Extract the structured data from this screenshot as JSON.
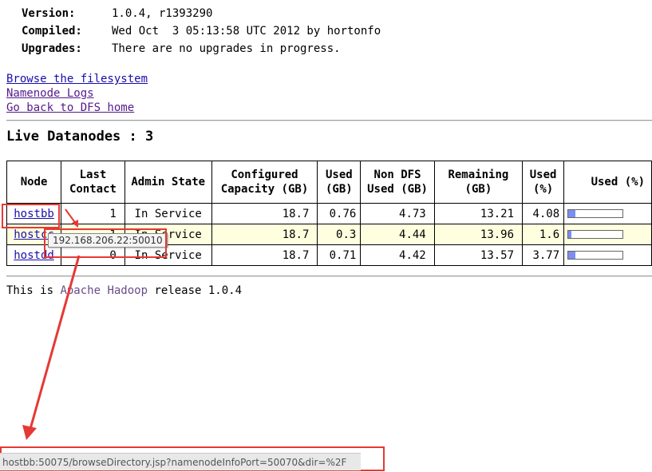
{
  "info": [
    {
      "label": "Version:",
      "value": "1.0.4, r1393290"
    },
    {
      "label": "Compiled:",
      "value": "Wed Oct  3 05:13:58 UTC 2012 by hortonfo"
    },
    {
      "label": "Upgrades:",
      "value": "There are no upgrades in progress."
    }
  ],
  "links": {
    "browse": "Browse the filesystem",
    "logs": "Namenode Logs",
    "home": "Go back to DFS home"
  },
  "section_title": "Live Datanodes : 3",
  "table": {
    "headers": {
      "node": "Node",
      "last_contact": "Last Contact",
      "admin_state": "Admin State",
      "capacity": "Configured Capacity (GB)",
      "used_gb": "Used (GB)",
      "non_dfs": "Non DFS Used (GB)",
      "remaining": "Remaining (GB)",
      "used_pct": "Used (%)",
      "used_bar": "Used (%)"
    },
    "rows": [
      {
        "node": "hostbb",
        "last_contact": "1",
        "admin_state": "In Service",
        "capacity": "18.7",
        "used": "0.76",
        "non_dfs": "4.73",
        "remaining": "13.21",
        "used_pct": "4.08"
      },
      {
        "node": "hostcc",
        "last_contact": "1",
        "admin_state": "In Service",
        "capacity": "18.7",
        "used": "0.3",
        "non_dfs": "4.44",
        "remaining": "13.96",
        "used_pct": "1.6"
      },
      {
        "node": "hostdd",
        "last_contact": "0",
        "admin_state": "In Service",
        "capacity": "18.7",
        "used": "0.71",
        "non_dfs": "4.42",
        "remaining": "13.57",
        "used_pct": "3.77"
      }
    ]
  },
  "release": {
    "prefix": "This is ",
    "link": "Apache Hadoop",
    "suffix": " release 1.0.4"
  },
  "tooltip": "192.168.206.22:50010",
  "status_url": "hostbb:50075/browseDirectory.jsp?namenodeInfoPort=50070&dir=%2F",
  "colors": {
    "annotation": "#e53935",
    "bar_fill": "#7c8ef0",
    "alt_row": "#ffffe0"
  }
}
